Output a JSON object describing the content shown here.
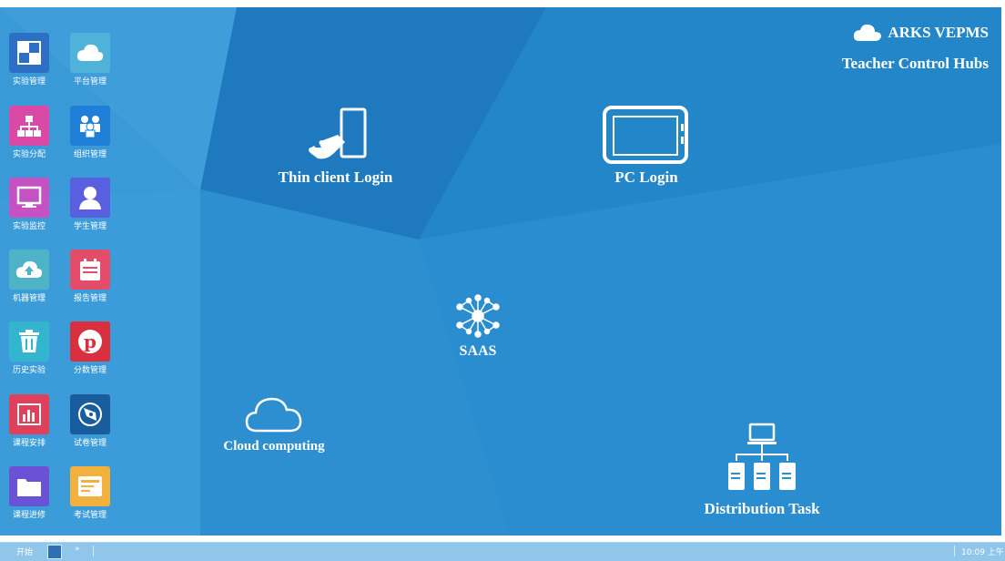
{
  "brand": {
    "name": "ARKS VEPMS",
    "subtitle": "Teacher Control Hubs",
    "icon": "cloud-icon"
  },
  "sidebar": {
    "tiles": [
      {
        "label": "实验管理",
        "icon": "grid-icon",
        "color": "#2d6fc4"
      },
      {
        "label": "平台管理",
        "icon": "cloud-icon",
        "color": "#4fb3d9"
      },
      {
        "label": "实验分配",
        "icon": "hierarchy-icon",
        "color": "#d94aa6"
      },
      {
        "label": "组织管理",
        "icon": "users-icon",
        "color": "#1f7fd6"
      },
      {
        "label": "实验监控",
        "icon": "monitor-icon",
        "color": "#c552c2"
      },
      {
        "label": "学生管理",
        "icon": "user-icon",
        "color": "#5a5fe0"
      },
      {
        "label": "机器管理",
        "icon": "upload-cloud-icon",
        "color": "#4fb3c8"
      },
      {
        "label": "报告管理",
        "icon": "calendar-icon",
        "color": "#e34d6a"
      },
      {
        "label": "历史实验",
        "icon": "trash-icon",
        "color": "#33b5cf"
      },
      {
        "label": "分数管理",
        "icon": "pinterest-icon",
        "color": "#d9303f"
      },
      {
        "label": "课程安排",
        "icon": "bar-chart-icon",
        "color": "#e0405a"
      },
      {
        "label": "试卷管理",
        "icon": "compass-icon",
        "color": "#1a5d9c"
      },
      {
        "label": "课程进修",
        "icon": "folder-icon",
        "color": "#6a52d6"
      },
      {
        "label": "考试管理",
        "icon": "document-icon",
        "color": "#f2b03c"
      }
    ]
  },
  "hubs": {
    "thin_client": {
      "label": "Thin client Login",
      "icon": "touch-tablet-icon"
    },
    "pc_login": {
      "label": "PC Login",
      "icon": "tablet-icon"
    },
    "saas": {
      "label": "SAAS",
      "icon": "network-icon"
    },
    "cloud": {
      "label": "Cloud  computing",
      "icon": "cloud-outline-icon"
    },
    "distribution": {
      "label": "Distribution Task",
      "icon": "distribution-icon"
    }
  },
  "taskbar": {
    "start": "开始",
    "arrows": "»",
    "clock": "10:09 上午"
  }
}
